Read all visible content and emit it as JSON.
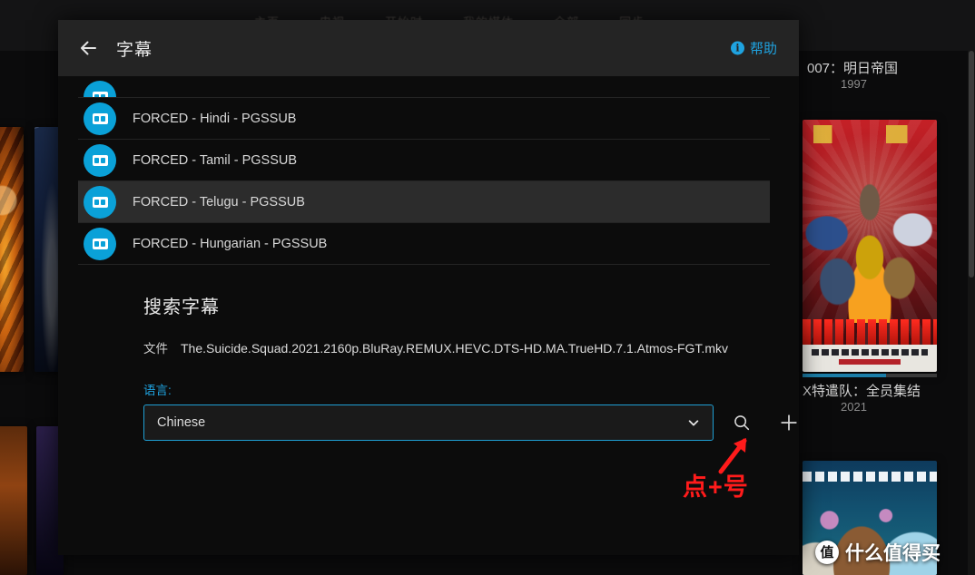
{
  "background": {
    "nav_items": [
      "主页",
      "电视",
      "开始时",
      "我的媒体",
      "全部",
      "同步"
    ],
    "cards": [
      {
        "title": "007：明日帝国",
        "year": "1997"
      },
      {
        "title": "X特遣队：全员集结",
        "year": "2021"
      }
    ],
    "watermark": {
      "logo": "值",
      "text": "什么值得买"
    }
  },
  "dialog": {
    "back_icon": "arrow-left-icon",
    "title": "字幕",
    "help": {
      "label": "帮助",
      "icon": "info-icon",
      "color": "#1fa3e0"
    },
    "subtitle_list": [
      {
        "label": "",
        "icon": "cc-icon",
        "partial": true,
        "hovered": false
      },
      {
        "label": "FORCED - Hindi - PGSSUB",
        "icon": "cc-icon",
        "partial": false,
        "hovered": false
      },
      {
        "label": "FORCED - Tamil - PGSSUB",
        "icon": "cc-icon",
        "partial": false,
        "hovered": false
      },
      {
        "label": "FORCED - Telugu - PGSSUB",
        "icon": "cc-icon",
        "partial": false,
        "hovered": true
      },
      {
        "label": "FORCED - Hungarian - PGSSUB",
        "icon": "cc-icon",
        "partial": false,
        "hovered": false
      }
    ],
    "search": {
      "heading": "搜索字幕",
      "file_label": "文件",
      "file_name": "The.Suicide.Squad.2021.2160p.BluRay.REMUX.HEVC.DTS-HD.MA.TrueHD.7.1.Atmos-FGT.mkv",
      "language_label": "语言:",
      "language_value": "Chinese",
      "language_options": [
        "Chinese"
      ],
      "chevron_icon": "chevron-down-icon",
      "search_icon": "search-icon",
      "add_icon": "plus-icon",
      "border_color": "#1f9fd4"
    }
  },
  "annotation": {
    "text": "点+号",
    "color": "#ff1b1b",
    "arrow_icon": "arrow-up-right-icon"
  }
}
